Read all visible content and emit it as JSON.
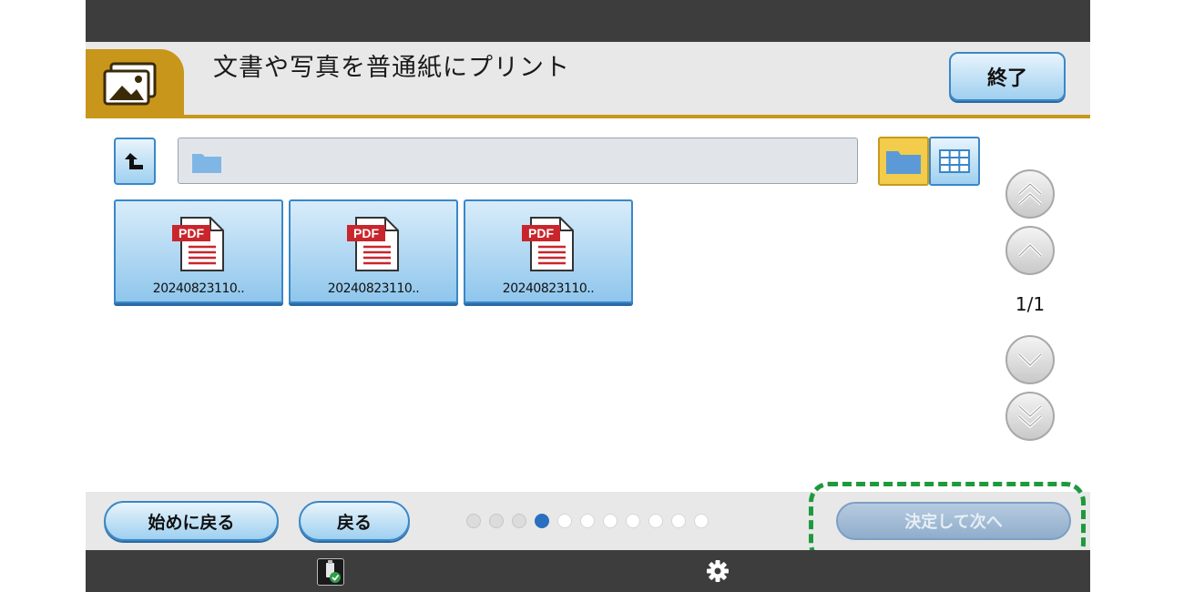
{
  "header": {
    "title": "文書や写真を普通紙にプリント",
    "end_label": "終了"
  },
  "files": [
    {
      "name": "20240823110..",
      "type": "PDF"
    },
    {
      "name": "20240823110..",
      "type": "PDF"
    },
    {
      "name": "20240823110..",
      "type": "PDF"
    }
  ],
  "pager": {
    "page": "1/1"
  },
  "footer": {
    "home_label": "始めに戻る",
    "back_label": "戻る",
    "next_label": "決定して次へ",
    "steps_total": 11,
    "step_current": 4
  },
  "colors": {
    "accent": "#c9961c",
    "button_blue": "#3a87c8",
    "highlight": "#1e9a3d",
    "active_dot": "#2a6fc0"
  },
  "icons": [
    "photo-app-icon",
    "up-arrow-icon",
    "folder-icon",
    "grid-view-icon",
    "pdf-file-icon",
    "double-chevron-up-icon",
    "chevron-up-icon",
    "chevron-down-icon",
    "double-chevron-down-icon",
    "usb-memory-icon",
    "gear-icon"
  ]
}
